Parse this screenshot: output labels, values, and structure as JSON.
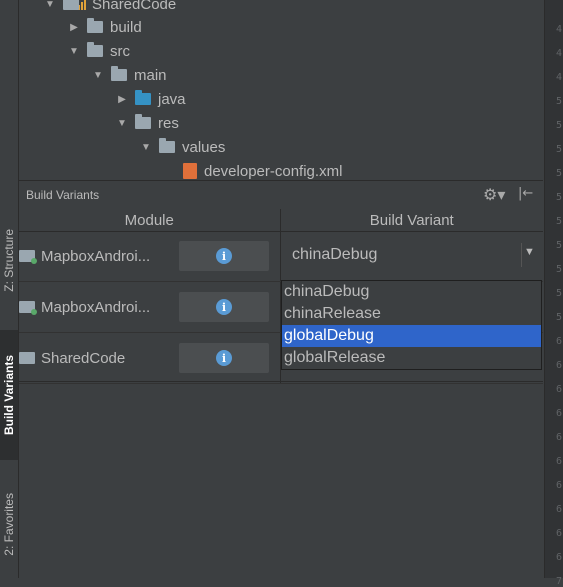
{
  "tool_strip": {
    "structure": "Z: Structure",
    "build_variants": "Build Variants",
    "favorites": "2: Favorites"
  },
  "tree": {
    "items": [
      {
        "label": "SharedCode",
        "expanded": true
      },
      {
        "label": "build",
        "expanded": false
      },
      {
        "label": "src",
        "expanded": true
      },
      {
        "label": "main",
        "expanded": true
      },
      {
        "label": "java",
        "expanded": false
      },
      {
        "label": "res",
        "expanded": true
      },
      {
        "label": "values",
        "expanded": true
      },
      {
        "label": "developer-config.xml"
      }
    ]
  },
  "panel": {
    "title": "Build Variants",
    "columns": {
      "module": "Module",
      "variant": "Build Variant"
    },
    "modules": [
      {
        "name": "MapboxAndroi..."
      },
      {
        "name": "MapboxAndroi..."
      },
      {
        "name": "SharedCode"
      }
    ],
    "combo": {
      "value": "chinaDebug"
    },
    "options": [
      "chinaDebug",
      "chinaRelease",
      "globalDebug",
      "globalRelease"
    ],
    "selected_option": "globalDebug"
  },
  "gutter": {
    "line_numbers": [
      "4",
      "4",
      "4",
      "5",
      "5",
      "5",
      "5",
      "5",
      "5",
      "5",
      "5",
      "5",
      "5",
      "6",
      "6",
      "6",
      "6",
      "6",
      "6",
      "6",
      "6",
      "6",
      "6",
      "7"
    ]
  },
  "colors": {
    "background": "#3c3f41",
    "selection": "#2f65ca",
    "info": "#5a9bd5",
    "text": "#bbbbbb"
  },
  "icons": {
    "gear": "gear-icon",
    "hide": "hide-panel-icon",
    "info": "info-icon",
    "dropdown": "chevron-down-icon"
  }
}
